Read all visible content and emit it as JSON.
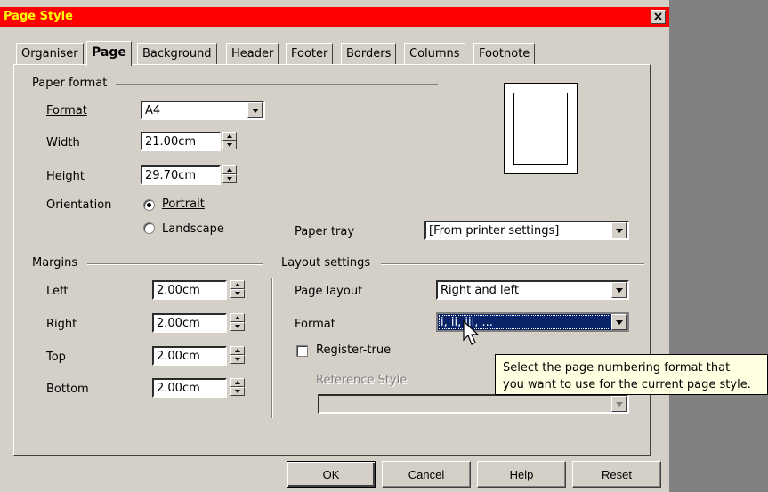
{
  "window": {
    "title": "Page Style",
    "close_label": "✕"
  },
  "tabs": [
    {
      "label": "Organiser",
      "active": false
    },
    {
      "label": "Page",
      "active": true
    },
    {
      "label": "Background",
      "active": false
    },
    {
      "label": "Header",
      "active": false
    },
    {
      "label": "Footer",
      "active": false
    },
    {
      "label": "Borders",
      "active": false
    },
    {
      "label": "Columns",
      "active": false
    },
    {
      "label": "Footnote",
      "active": false
    }
  ],
  "paper_format": {
    "group_label": "Paper format",
    "format_label": "Format",
    "format_value": "A4",
    "width_label": "Width",
    "width_value": "21.00cm",
    "height_label": "Height",
    "height_value": "29.70cm",
    "orientation_label": "Orientation",
    "portrait_label": "Portrait",
    "portrait_selected": true,
    "landscape_label": "Landscape",
    "paper_tray_label": "Paper tray",
    "paper_tray_value": "[From printer settings]"
  },
  "margins": {
    "group_label": "Margins",
    "left_label": "Left",
    "left_value": "2.00cm",
    "right_label": "Right",
    "right_value": "2.00cm",
    "top_label": "Top",
    "top_value": "2.00cm",
    "bottom_label": "Bottom",
    "bottom_value": "2.00cm"
  },
  "layout": {
    "group_label": "Layout settings",
    "page_layout_label": "Page layout",
    "page_layout_value": "Right and left",
    "format_label": "Format",
    "format_value": "i, ii, iii, ...",
    "register_true_label": "Register-true",
    "register_true_checked": false,
    "reference_style_label": "Reference Style",
    "reference_style_value": ""
  },
  "tooltip": {
    "line1": "Select the page numbering format that",
    "line2": "you want to use for the current page style."
  },
  "buttons": {
    "ok": "OK",
    "cancel": "Cancel",
    "help": "Help",
    "reset": "Reset"
  },
  "colors": {
    "titlebar": "#ff0000",
    "title_text": "#ffff00",
    "selection": "#0a246a",
    "tooltip_bg": "#ffffe1"
  },
  "icons": {
    "close": "close-icon",
    "cursor": "mouse-pointer-icon",
    "dropdown": "chevron-down-icon"
  }
}
